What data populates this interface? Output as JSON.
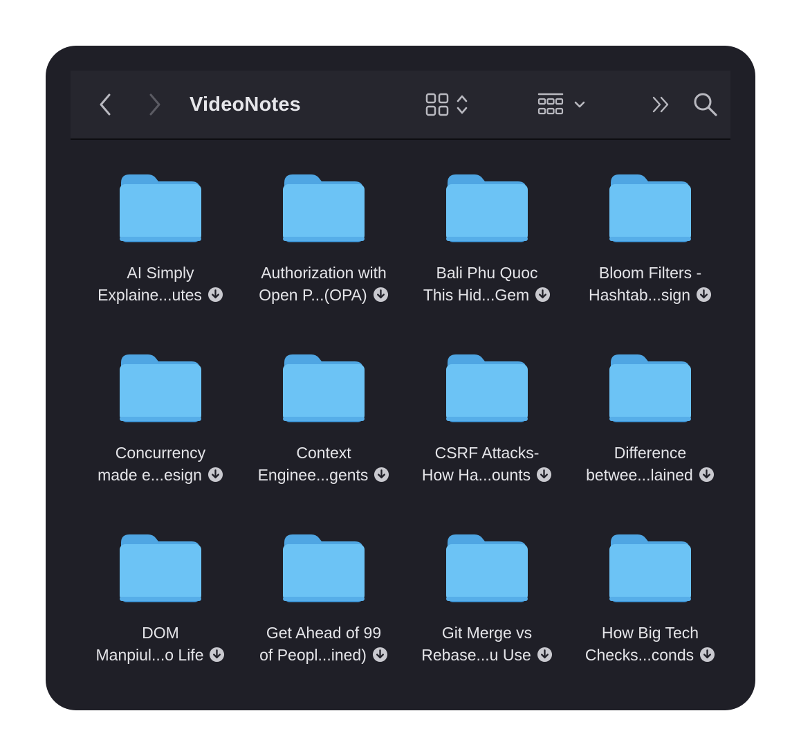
{
  "window": {
    "title": "VideoNotes"
  },
  "toolbar": {
    "back_icon": "chevron-left-icon",
    "forward_icon": "chevron-right-icon",
    "view_icon": "grid-view-icon",
    "group_icon": "group-by-icon",
    "more_icon": "double-chevron-right-icon",
    "search_icon": "search-icon"
  },
  "colors": {
    "window_bg": "#1f1f27",
    "toolbar_bg": "#26262e",
    "folder_blue": "#6cc3f5",
    "folder_tab": "#4fa6e3",
    "text": "#e4e4e8"
  },
  "items": [
    {
      "line1": "AI Simply",
      "line2": "Explaine...utes"
    },
    {
      "line1": "Authorization with",
      "line2": "Open P...(OPA)"
    },
    {
      "line1": "Bali Phu Quoc",
      "line2": "This Hid...Gem"
    },
    {
      "line1": "Bloom Filters -",
      "line2": "Hashtab...sign"
    },
    {
      "line1": "Concurrency",
      "line2": "made e...esign"
    },
    {
      "line1": "Context",
      "line2": "Enginee...gents"
    },
    {
      "line1": "CSRF Attacks-",
      "line2": "How Ha...ounts"
    },
    {
      "line1": "Difference",
      "line2": "betwee...lained"
    },
    {
      "line1": "DOM",
      "line2": "Manpiul...o Life"
    },
    {
      "line1": "Get Ahead of 99",
      "line2": "of Peopl...ined)"
    },
    {
      "line1": "Git Merge vs",
      "line2": "Rebase...u Use"
    },
    {
      "line1": "How Big Tech",
      "line2": "Checks...conds"
    }
  ]
}
